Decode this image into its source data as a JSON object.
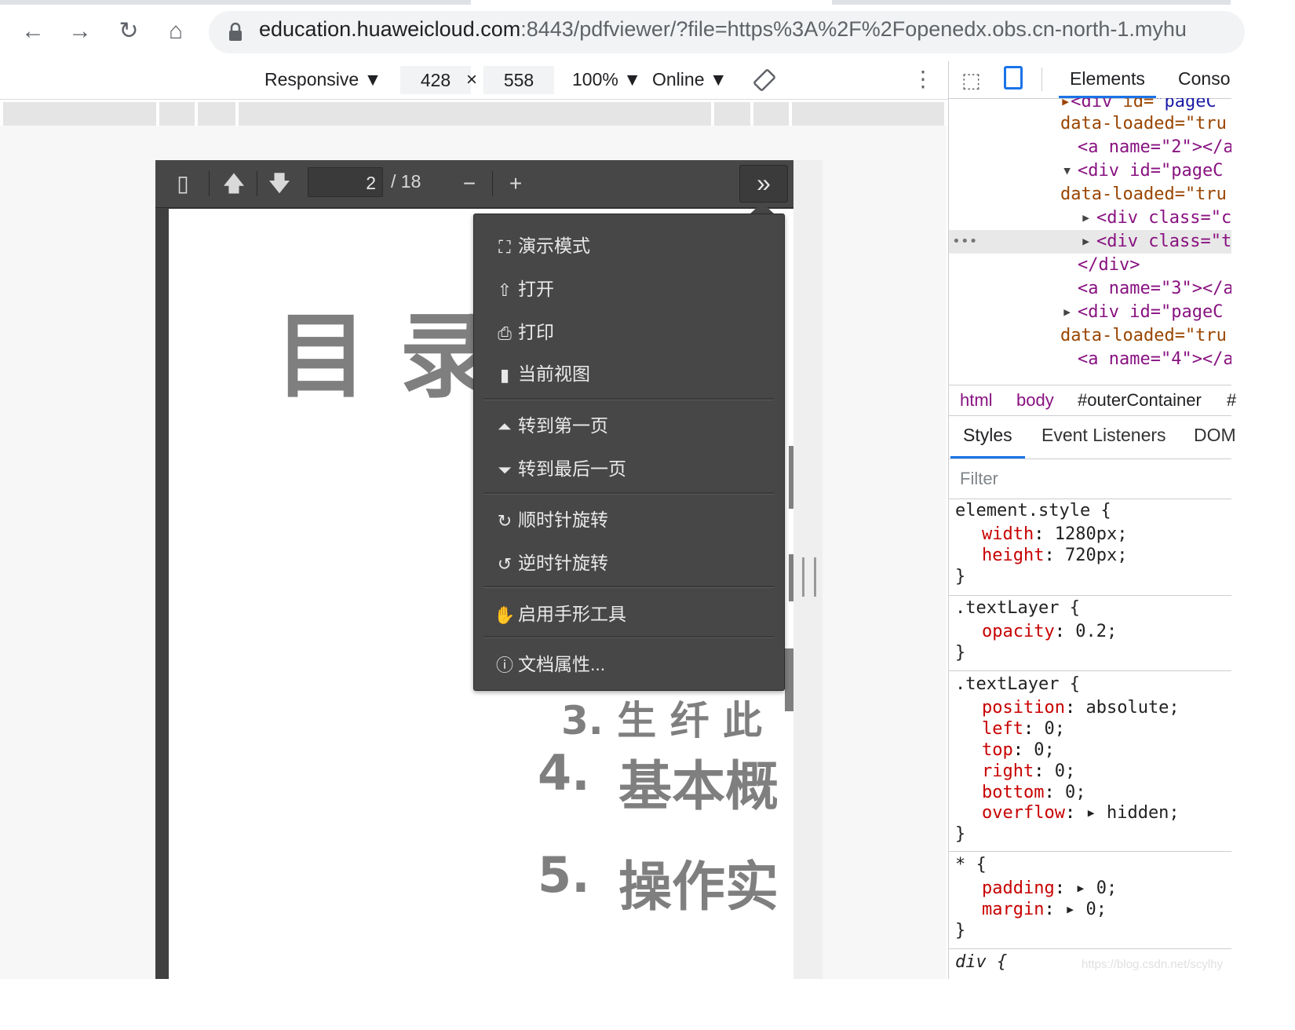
{
  "browser": {
    "url_host": "education.huaweicloud.com",
    "url_rest": ":8443/pdfviewer/?file=https%3A%2F%2Fopenedx.obs.cn-north-1.myhu"
  },
  "device_toolbar": {
    "mode": "Responsive ▼",
    "width": "428",
    "x": "×",
    "height": "558",
    "zoom": "100% ▼",
    "network": "Online ▼"
  },
  "pdf": {
    "page_number": "2",
    "page_total": "/ 18",
    "title": "目 录",
    "toc_items": [
      {
        "num": "4.",
        "text": "基本概"
      },
      {
        "num": "5.",
        "text": "操作实"
      }
    ],
    "fragment_3": "3.   生  纤  此"
  },
  "menu": {
    "items": [
      {
        "icon": "presentation-mode-icon",
        "glyph": "⛶",
        "label": "演示模式"
      },
      {
        "icon": "open-file-icon",
        "glyph": "⇧",
        "label": "打开"
      },
      {
        "icon": "print-icon",
        "glyph": "⎙",
        "label": "打印"
      },
      {
        "icon": "bookmark-icon",
        "glyph": "▮",
        "label": "当前视图"
      },
      {
        "icon": "first-page-icon",
        "glyph": "⏶",
        "label": "转到第一页"
      },
      {
        "icon": "last-page-icon",
        "glyph": "⏷",
        "label": "转到最后一页"
      },
      {
        "icon": "rotate-cw-icon",
        "glyph": "↻",
        "label": "顺时针旋转"
      },
      {
        "icon": "rotate-ccw-icon",
        "glyph": "↺",
        "label": "逆时针旋转"
      },
      {
        "icon": "hand-tool-icon",
        "glyph": "✋",
        "label": "启用手形工具"
      },
      {
        "icon": "info-icon",
        "glyph": "ⓘ",
        "label": "文档属性..."
      }
    ]
  },
  "devtools": {
    "tabs": [
      "Elements",
      "Conso"
    ],
    "breadcrumbs": [
      "html",
      "body",
      "#outerContainer",
      "#"
    ],
    "styles_tabs": [
      "Styles",
      "Event Listeners",
      "DOM"
    ],
    "filter_placeholder": "Filter",
    "dom_lines": [
      "data-loaded=\"tru",
      "<a name=\"2\"></a",
      "<div id=\"pageC",
      "data-loaded=\"tru",
      "<div class=\"c",
      "<div class=\"t",
      "</div>",
      "<a name=\"3\"></a",
      "<div id=\"pageC",
      "data-loaded=\"tru",
      "<a name=\"4\"></a"
    ],
    "rules": [
      {
        "selector": "element.style {",
        "decls": [
          [
            "width",
            "1280px;"
          ],
          [
            "height",
            "720px;"
          ]
        ]
      },
      {
        "selector": ".textLayer {",
        "decls": [
          [
            "opacity",
            "0.2;"
          ]
        ]
      },
      {
        "selector": ".textLayer {",
        "decls": [
          [
            "position",
            "absolute;"
          ],
          [
            "left",
            "0;"
          ],
          [
            "top",
            "0;"
          ],
          [
            "right",
            "0;"
          ],
          [
            "bottom",
            "0;"
          ],
          [
            "overflow",
            "▸ hidden;"
          ]
        ]
      },
      {
        "selector": "* {",
        "decls": [
          [
            "padding",
            "▸ 0;"
          ],
          [
            "margin",
            "▸ 0;"
          ]
        ]
      },
      {
        "selector": "div {",
        "decls": []
      }
    ],
    "close_brace": "}"
  },
  "watermark": "https://blog.csdn.net/scylhy"
}
